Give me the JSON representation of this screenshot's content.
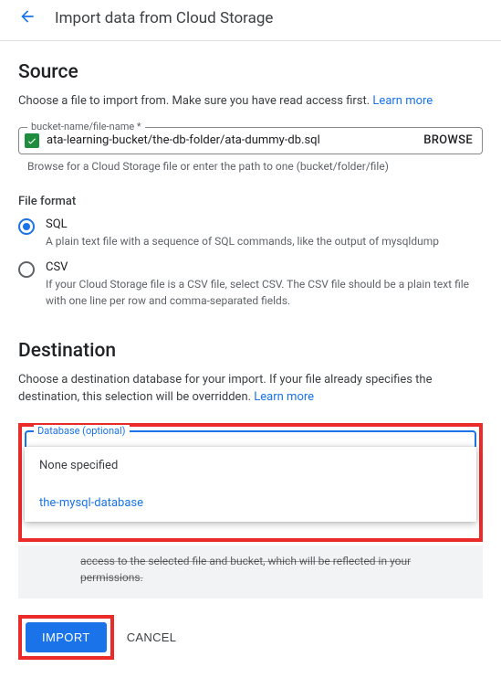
{
  "header": {
    "title": "Import data from Cloud Storage"
  },
  "source": {
    "heading": "Source",
    "description_pre": "Choose a file to import from. Make sure you have read access first. ",
    "learn_more": "Learn more",
    "field_label": "bucket-name/file-name *",
    "field_value": "ata-learning-bucket/the-db-folder/ata-dummy-db.sql",
    "browse": "BROWSE",
    "field_help": "Browse for a Cloud Storage file or enter the path to one (bucket/folder/file)"
  },
  "file_format": {
    "label": "File format",
    "options": [
      {
        "value": "SQL",
        "desc": "A plain text file with a sequence of SQL commands, like the output of mysqldump",
        "selected": true
      },
      {
        "value": "CSV",
        "desc": "If your Cloud Storage file is a CSV file, select CSV. The CSV file should be a plain text file with one line per row and comma-separated fields.",
        "selected": false
      }
    ]
  },
  "destination": {
    "heading": "Destination",
    "description_pre": "Choose a destination database for your import. If your file already specifies the destination, this selection will be overridden. ",
    "learn_more": "Learn more",
    "dropdown_label": "Database (optional)",
    "dropdown_items": {
      "none": "None specified",
      "db": "the-mysql-database"
    },
    "info_remnant_line1": "access to the selected file and bucket, which will be reflected in your",
    "info_remnant_line2": "permissions."
  },
  "actions": {
    "import": "IMPORT",
    "cancel": "CANCEL"
  }
}
